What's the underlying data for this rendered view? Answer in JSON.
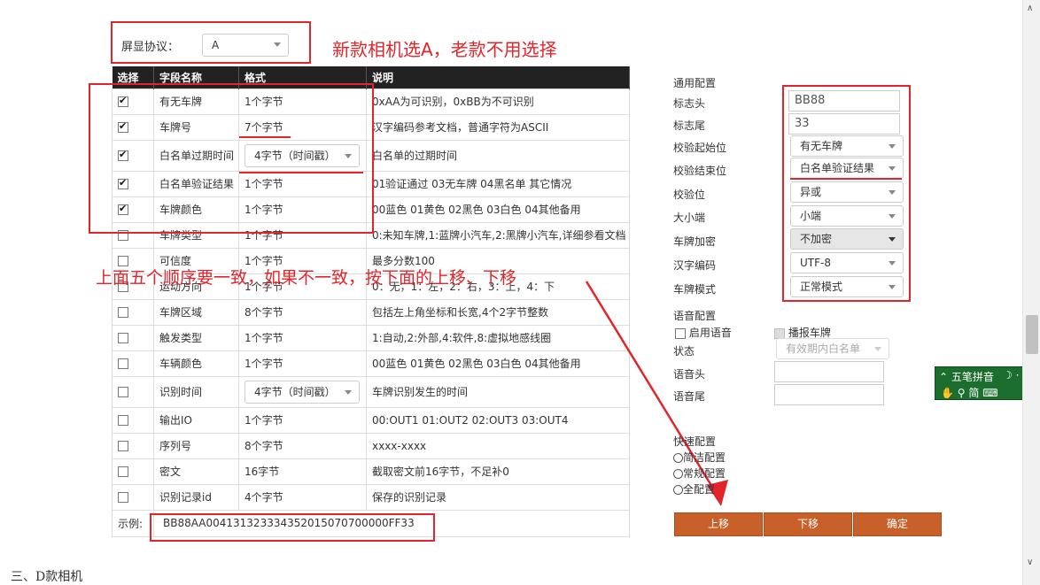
{
  "protocol": {
    "label": "屏显协议：",
    "value": "A"
  },
  "annotations": {
    "top": "新款相机选A，老款不用选择",
    "middle": "上面五个顺序要一致，如果不一致，按下面的上移、下移"
  },
  "table": {
    "headers": [
      "选择",
      "字段名称",
      "格式",
      "说明"
    ],
    "rows": [
      {
        "checked": true,
        "name": "有无车牌",
        "format": "1个字节",
        "desc": "0xAA为可识别，0xBB为不可识别"
      },
      {
        "checked": true,
        "name": "车牌号",
        "format": "7个字节",
        "desc": "汉字编码参考文档，普通字符为ASCII"
      },
      {
        "checked": true,
        "name": "白名单过期时间",
        "format": "4字节（时间戳）",
        "desc": "白名单的过期时间",
        "select": true
      },
      {
        "checked": true,
        "name": "白名单验证结果",
        "format": "1个字节",
        "desc": "01验证通过 03无车牌 04黑名单 其它情况"
      },
      {
        "checked": true,
        "name": "车牌颜色",
        "format": "1个字节",
        "desc": "00蓝色 01黄色 02黑色 03白色 04其他备用"
      },
      {
        "checked": false,
        "name": "车牌类型",
        "format": "1个字节",
        "desc": "0:未知车牌,1:蓝牌小汽车,2:黑牌小汽车,详细参看文档"
      },
      {
        "checked": false,
        "name": "可信度",
        "format": "1个字节",
        "desc": "最多分数100"
      },
      {
        "checked": false,
        "name": "运动方向",
        "format": "1个字节",
        "desc": "0：无，1：左，2：右，3：上，4：下"
      },
      {
        "checked": false,
        "name": "车牌区域",
        "format": "8个字节",
        "desc": "包括左上角坐标和长宽,4个2字节整数"
      },
      {
        "checked": false,
        "name": "触发类型",
        "format": "1个字节",
        "desc": "1:自动,2:外部,4:软件,8:虚拟地感线圈"
      },
      {
        "checked": false,
        "name": "车辆颜色",
        "format": "1个字节",
        "desc": "00蓝色 01黄色 02黑色 03白色 04其他备用"
      },
      {
        "checked": false,
        "name": "识别时间",
        "format": "4字节（时间戳）",
        "desc": "车牌识别发生的时间",
        "select": true
      },
      {
        "checked": false,
        "name": "输出IO",
        "format": "1个字节",
        "desc": "00:OUT1 01:OUT2 02:OUT3 03:OUT4"
      },
      {
        "checked": false,
        "name": "序列号",
        "format": "8个字节",
        "desc": "xxxx-xxxx"
      },
      {
        "checked": false,
        "name": "密文",
        "format": "16字节",
        "desc": "截取密文前16字节，不足补0"
      },
      {
        "checked": false,
        "name": "识别记录id",
        "format": "4个字节",
        "desc": "保存的识别记录"
      }
    ],
    "example_label": "示例:",
    "example_value": "BB88AA004131323334352015070700000FF33"
  },
  "general": {
    "title": "通用配置",
    "head_label": "标志头",
    "head_value": "BB88",
    "tail_label": "标志尾",
    "tail_value": "33",
    "check_start_label": "校验起始位",
    "check_start_value": "有无车牌",
    "check_end_label": "校验结束位",
    "check_end_value": "白名单验证结果",
    "check_bit_label": "校验位",
    "check_bit_value": "异或",
    "endian_label": "大小端",
    "endian_value": "小端",
    "encrypt_label": "车牌加密",
    "encrypt_value": "不加密",
    "encoding_label": "汉字编码",
    "encoding_value": "UTF-8",
    "mode_label": "车牌模式",
    "mode_value": "正常模式"
  },
  "voice": {
    "title": "语音配置",
    "enable_label": "启用语音",
    "broadcast_label": "播报车牌",
    "status_label": "状态",
    "status_value": "有效期内白名单",
    "head_label": "语音头",
    "tail_label": "语音尾"
  },
  "quick": {
    "title": "快速配置",
    "options": [
      "简洁配置",
      "常规配置",
      "全配置"
    ]
  },
  "buttons": {
    "up": "上移",
    "down": "下移",
    "confirm": "确定"
  },
  "ime": {
    "row1": "五笔拼音",
    "row2": "简"
  },
  "footer": "三、D款相机",
  "colors": {
    "annotation": "#e3242b",
    "button": "#c8602a",
    "header": "#222222"
  }
}
